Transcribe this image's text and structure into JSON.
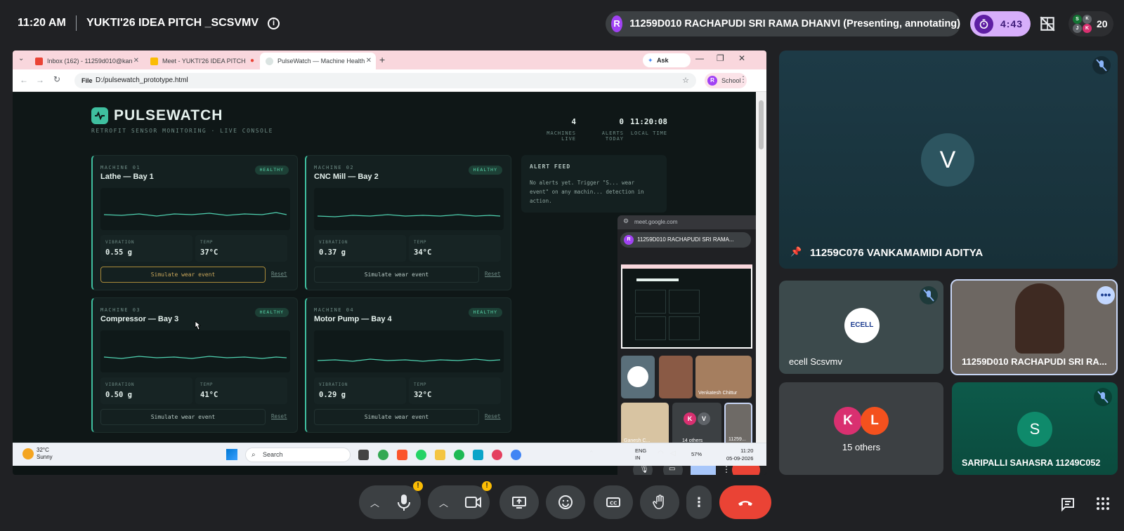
{
  "meeting": {
    "time": "11:20 AM",
    "title": "YUKTI'26 IDEA PITCH _SCSVMV",
    "presenter_initial": "R",
    "presenter_label": "11259D010 RACHAPUDI SRI RAMA DHANVI (Presenting, annotating)",
    "timer": "4:43",
    "participant_count": "20"
  },
  "browser": {
    "tabs": [
      {
        "label": "Inbox (162) - 11259d010@kan"
      },
      {
        "label": "Meet - YUKTI'26 IDEA PITCH"
      },
      {
        "label": "PulseWatch — Machine Health"
      }
    ],
    "new_tab": "+",
    "ask_gemini": "Ask Gemini",
    "url_scheme": "File",
    "url": "D:/pulsewatch_prototype.html",
    "profile_initial": "R",
    "profile": "School"
  },
  "pulsewatch": {
    "brand": "PULSEWATCH",
    "tagline": "RETROFIT SENSOR MONITORING · LIVE CONSOLE",
    "stats": [
      {
        "value": "4",
        "label": "MACHINES LIVE"
      },
      {
        "value": "0",
        "label": "ALERTS TODAY"
      },
      {
        "value": "11:20:08",
        "label": "LOCAL TIME"
      }
    ],
    "vib_label": "VIBRATION",
    "temp_label": "TEMP",
    "simulate_label": "Simulate wear event",
    "reset_label": "Reset",
    "machines": [
      {
        "num": "MACHINE 01",
        "name": "Lathe — Bay 1",
        "status": "HEALTHY",
        "vibration": "0.55 g",
        "temp": "37°C"
      },
      {
        "num": "MACHINE 02",
        "name": "CNC Mill — Bay 2",
        "status": "HEALTHY",
        "vibration": "0.37 g",
        "temp": "34°C"
      },
      {
        "num": "MACHINE 03",
        "name": "Compressor — Bay 3",
        "status": "HEALTHY",
        "vibration": "0.50 g",
        "temp": "41°C"
      },
      {
        "num": "MACHINE 04",
        "name": "Motor Pump — Bay 4",
        "status": "HEALTHY",
        "vibration": "0.29 g",
        "temp": "32°C"
      }
    ],
    "alert_feed_title": "ALERT FEED",
    "alert_feed_body": "No alerts yet. Trigger \"S... wear event\" on any machin... detection in action."
  },
  "mini_meet": {
    "url": "meet.google.com",
    "presenter": "11259D010 RACHAPUDI SRI RAMA...",
    "tiles": [
      "Venkatesh Chittur",
      "Ganesh C...",
      "14 others",
      "11259..."
    ],
    "others_initials": [
      "K",
      "V"
    ]
  },
  "taskbar": {
    "weather_temp": "32°C",
    "weather_desc": "Sunny",
    "search": "Search",
    "lang1": "ENG",
    "lang2": "IN",
    "battery": "57%",
    "time": "11:20",
    "date": "05-09-2026"
  },
  "participants": {
    "main": {
      "initial": "V",
      "name": "11259C076 VANKAMAMIDI ADITYA"
    },
    "ecell": {
      "name": "ecell Scsvmv",
      "logo_text": "ECELL"
    },
    "rachapudi": {
      "name": "11259D010 RACHAPUDI SRI RA..."
    },
    "others": {
      "initials": [
        "K",
        "L"
      ],
      "label": "15 others"
    },
    "saripalli": {
      "initial": "S",
      "name": "SARIPALLI SAHASRA 11249C052"
    }
  },
  "colors": {
    "accent": "#3fbf9f",
    "meet_bg": "#202124",
    "end_call": "#ea4335"
  }
}
